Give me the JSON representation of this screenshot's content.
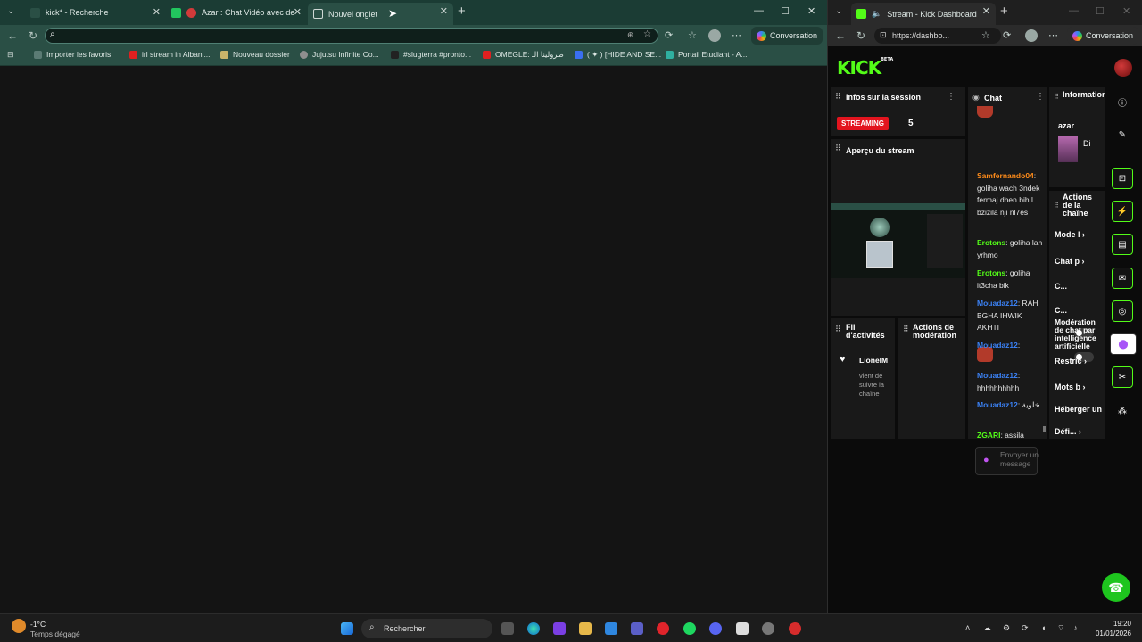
{
  "left_browser": {
    "tabs": [
      {
        "label": "kick* - Recherche",
        "active": false
      },
      {
        "label": "Azar : Chat Vidéo avec de no",
        "active": false
      },
      {
        "label": "Nouvel onglet",
        "active": true
      }
    ],
    "address_value": "",
    "conversation_label": "Conversation",
    "bookmarks": [
      {
        "label": "Importer les favoris",
        "color": "#5b7b74"
      },
      {
        "label": "irl stream in Albani...",
        "color": "#e02020"
      },
      {
        "label": "Nouveau dossier",
        "color": "#c9b56a"
      },
      {
        "label": "Jujutsu Infinite Co...",
        "color": "#8f8f8f"
      },
      {
        "label": "#slugterra #pronto...",
        "color": "#222222"
      },
      {
        "label": "OMEGLE: طرولينا الـ",
        "color": "#e02020"
      },
      {
        "label": "( ✦ ) [HIDE AND SE...",
        "color": "#3a6ff0"
      },
      {
        "label": "Portail Etudiant - A...",
        "color": "#2fb0a0"
      }
    ]
  },
  "right_browser": {
    "tab_label": "Stream - Kick Dashboard",
    "url": "https://dashbo...",
    "conversation_label": "Conversation",
    "kick": {
      "logo": "KICK",
      "logo_badge": "BETA",
      "session_info": {
        "title": "Infos sur la session",
        "status_badge": "STREAMING",
        "viewers": "5"
      },
      "preview_title": "Aperçu du stream",
      "activity": {
        "title": "Fil d'activités",
        "follower_name": "LionelM",
        "follower_text": "vient de suivre la chaîne"
      },
      "moderation": {
        "title": "Actions de modération"
      },
      "chat": {
        "title": "Chat",
        "messages": [
          {
            "user": "Samfernando04",
            "color": "#ff8c1a",
            "text": ": goliha wach 3ndek fermaj dhen bih l bzizila nji nl7es"
          },
          {
            "user": "Erotons",
            "color": "#53fc18",
            "text": ": goliha lah yrhmo"
          },
          {
            "user": "Erotons",
            "color": "#53fc18",
            "text": ": goliha it3cha bik"
          },
          {
            "user": "Mouadaz12",
            "color": "#3b82f6",
            "text": ": RAH BGHA IHWIK AKHTI"
          },
          {
            "user": "Mouadaz12",
            "color": "#3b82f6",
            "text": ":"
          },
          {
            "user": "Mouadaz12",
            "color": "#3b82f6",
            "text": ": hhhhhhhhhh"
          },
          {
            "user": "Mouadaz12",
            "color": "#3b82f6",
            "text": ": خلوية"
          },
          {
            "user": "ZGARI",
            "color": "#53fc18",
            "text": ": assila"
          }
        ],
        "input_placeholder": "Envoyer un message"
      },
      "stream_info": {
        "title": "Informations sur le stream",
        "name": "azar",
        "category": "Di"
      },
      "channel_actions": {
        "title": "Actions de la chaîne",
        "items": [
          "Mode l",
          "Chat p",
          "C...",
          "C...",
          "Modération de chat par intelligence artificielle",
          "Restric",
          "Mots b",
          "Héberger un",
          "Défi..."
        ]
      }
    }
  },
  "taskbar": {
    "weather_temp": "-1°C",
    "weather_desc": "Temps dégagé",
    "search_label": "Rechercher",
    "time": "19:20",
    "date": "01/01/2026"
  }
}
